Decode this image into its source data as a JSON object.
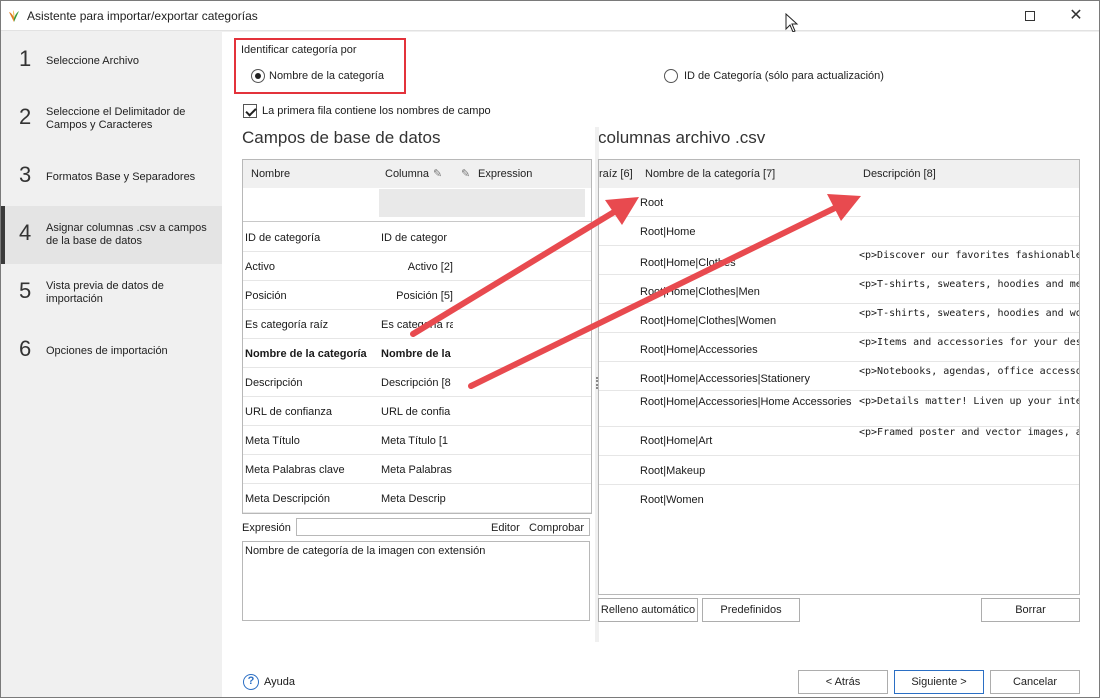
{
  "window": {
    "title": "Asistente para importar/exportar categorías",
    "maximize_icon": "maximize-icon",
    "close_icon": "close-icon"
  },
  "steps": [
    {
      "num": "1",
      "label": "Seleccione Archivo"
    },
    {
      "num": "2",
      "label": "Seleccione el Delimitador de Campos y Caracteres"
    },
    {
      "num": "3",
      "label": "Formatos Base y Separadores"
    },
    {
      "num": "4",
      "label": "Asignar columnas .csv a campos de la base de datos",
      "active": true
    },
    {
      "num": "5",
      "label": "Vista previa de datos de importación"
    },
    {
      "num": "6",
      "label": "Opciones de importación"
    }
  ],
  "identify": {
    "label": "Identificar categoría por",
    "option_name": "Nombre de la categoría",
    "option_id": "ID de Categoría (sólo para actualización)",
    "selected": "option_name"
  },
  "first_row_checkbox": {
    "label": "La primera fila contiene los nombres de campo",
    "checked": true
  },
  "db_section": {
    "title": "Campos de base de datos",
    "headers": {
      "name": "Nombre",
      "column": "Columna",
      "expression": "Expression"
    },
    "rows": [
      {
        "name": "ID de categoría",
        "column": "ID de categor",
        "align": "left"
      },
      {
        "name": "Activo",
        "column": "Activo [2]",
        "align": "right"
      },
      {
        "name": "Posición",
        "column": "Posición [5]",
        "align": "right"
      },
      {
        "name": "Es categoría raíz",
        "column": "Es categoría raíz",
        "align": "left"
      },
      {
        "name": "Nombre de la categoría",
        "column": "Nombre de la",
        "align": "left",
        "bold": true
      },
      {
        "name": "Descripción",
        "column": "Descripción [8",
        "align": "left"
      },
      {
        "name": "URL de confianza",
        "column": "URL de confia",
        "align": "left"
      },
      {
        "name": "Meta Título",
        "column": "Meta Título [1",
        "align": "left"
      },
      {
        "name": "Meta Palabras clave",
        "column": "Meta Palabras",
        "align": "left"
      },
      {
        "name": "Meta Descripción",
        "column": "Meta Descrip",
        "align": "left"
      }
    ]
  },
  "expression": {
    "label": "Expresión",
    "editor": "Editor",
    "check": "Comprobar",
    "text": "Nombre de categoría de la imagen con extensión"
  },
  "csv_section": {
    "title": "columnas archivo .csv",
    "headers": {
      "prev": "raíz [6]",
      "name": "Nombre de la categoría [7]",
      "desc": "Descripción [8]"
    },
    "rows": [
      {
        "name": "Root",
        "desc": ""
      },
      {
        "name": "Root|Home",
        "desc": ""
      },
      {
        "name": "Root|Home|Clothes",
        "desc": "<p>Discover our favorites fashionable disco"
      },
      {
        "name": "Root|Home|Clothes|Men",
        "desc": "<p>T-shirts, sweaters, hoodies and men's a"
      },
      {
        "name": "Root|Home|Clothes|Women",
        "desc": "<p>T-shirts, sweaters, hoodies and women'"
      },
      {
        "name": "Root|Home|Accessories",
        "desc": "<p>Items and accessories for your desk, kit"
      },
      {
        "name": "Root|Home|Accessories|Stationery",
        "desc": "<p>Notebooks, agendas, office accessorie"
      },
      {
        "name": "Root|Home|Accessories|Home Accessories",
        "desc": "<p>Details matter! Liven up your interior w"
      },
      {
        "name": "Root|Home|Art",
        "desc": "<p>Framed poster and vector images, all yo"
      },
      {
        "name": "Root|Makeup",
        "desc": ""
      },
      {
        "name": "Root|Women",
        "desc": ""
      }
    ]
  },
  "buttons": {
    "autofill": "Relleno automático",
    "predefined": "Predefinidos",
    "delete": "Borrar",
    "back": "< Atrás",
    "next": "Siguiente >",
    "cancel": "Cancelar",
    "help": "Ayuda"
  },
  "colors": {
    "highlight": "#e3323b",
    "arrow": "#e84a4f",
    "accent": "#2b6fc4"
  }
}
